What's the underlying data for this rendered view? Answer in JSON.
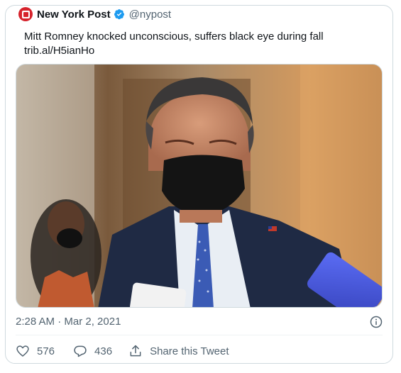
{
  "tweet": {
    "author_name": "New York Post",
    "handle": "@nypost",
    "text": "Mitt Romney knocked unconscious, suffers black eye during fall",
    "link": "trib.al/H5ianHo",
    "timestamp": "2:28 AM · Mar 2, 2021"
  },
  "actions": {
    "likes": "576",
    "replies": "436",
    "share_label": "Share this Tweet"
  },
  "colors": {
    "brand_red": "#d6232c",
    "verified_blue": "#1d9bf0",
    "secondary_text": "#536471",
    "border": "#cfd9de"
  },
  "icons": {
    "avatar": "new-york-post-logo",
    "verified": "verified-badge-icon",
    "info": "info-icon",
    "like": "heart-icon",
    "reply": "reply-bubble-icon",
    "share": "share-upload-icon"
  }
}
